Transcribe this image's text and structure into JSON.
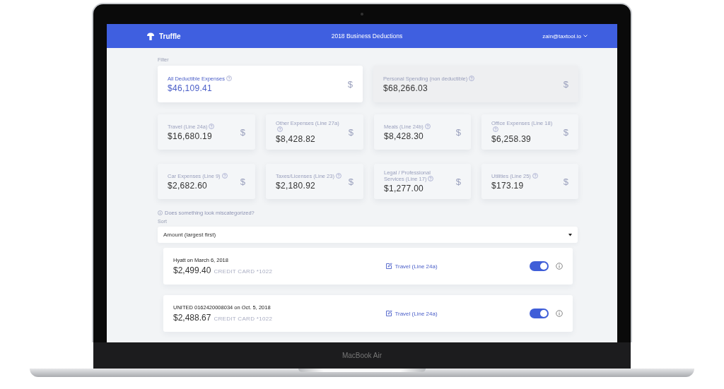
{
  "laptop": {
    "model_label": "MacBook Air"
  },
  "header": {
    "brand": "Truffle",
    "title": "2018 Business Deductions",
    "account": "zain@taxtool.io"
  },
  "filter": {
    "label": "Filter",
    "summary_cards": [
      {
        "label": "All Deductible Expenses",
        "amount": "$46,109.41",
        "icon": "$",
        "selected": true
      },
      {
        "label": "Personal Spending (non deductible)",
        "amount": "$68,266.03",
        "icon": "$",
        "selected": false
      }
    ],
    "category_cards": [
      {
        "label": "Travel (Line 24a)",
        "amount": "$16,680.19",
        "icon": "$"
      },
      {
        "label": "Other Expenses (Line 27a)",
        "amount": "$8,428.82",
        "icon": "$"
      },
      {
        "label": "Meals (Line 24b)",
        "amount": "$8,428.30",
        "icon": "$"
      },
      {
        "label": "Office Expenses (Line 18)",
        "amount": "$6,258.39",
        "icon": "$"
      },
      {
        "label": "Car Expenses (Line 9)",
        "amount": "$2,682.60",
        "icon": "$"
      },
      {
        "label": "Taxes/Licenses (Line 23)",
        "amount": "$2,180.92",
        "icon": "$"
      },
      {
        "label": "Legal / Professional Services (Line 17)",
        "amount": "$1,277.00",
        "icon": "$"
      },
      {
        "label": "Utilities (Line 25)",
        "amount": "$173.19",
        "icon": "$"
      }
    ]
  },
  "help_link": "Does something look miscategorized?",
  "sort": {
    "label": "Sort",
    "value": "Amount (largest first)"
  },
  "transactions": [
    {
      "title": "Hyatt on March 6, 2018",
      "amount": "$2,499.40",
      "account": "CREDIT CARD *1022",
      "category": "Travel (Line 24a)",
      "included": true
    },
    {
      "title": "UNITED 0162420008034 on Oct. 5, 2018",
      "amount": "$2,488.67",
      "account": "CREDIT CARD *1022",
      "category": "Travel (Line 24a)",
      "included": true
    }
  ]
}
